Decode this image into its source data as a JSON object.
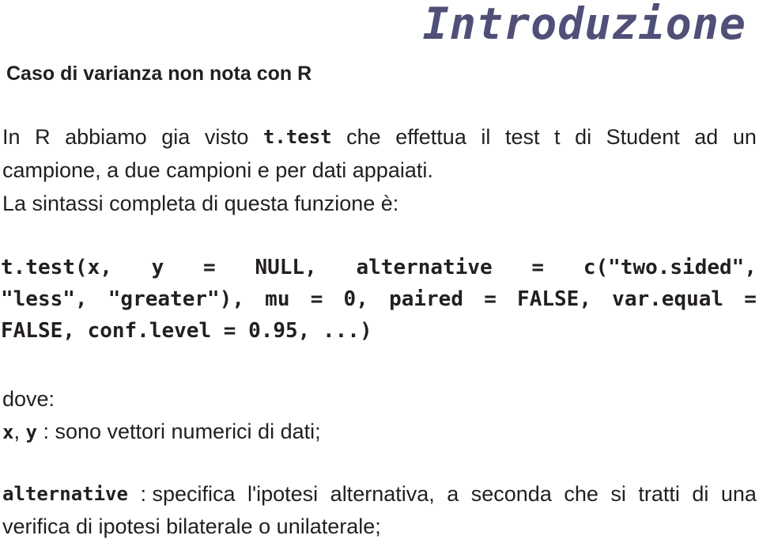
{
  "slide": {
    "title": "Introduzione",
    "subtitle": "Caso di varianza non nota con R",
    "title_color": "#4f4f78",
    "text_color": "#231f20",
    "background_color": "#ffffff"
  },
  "intro": {
    "line1_part1": "In",
    "line1_part2": "R",
    "line1_part3": "abbiamo",
    "line1_part4": "gia",
    "line1_part5": "visto",
    "line1_code": "t.test",
    "line1_part6": "che",
    "line1_part7": "effettua",
    "line1_part8": "il",
    "line1_part9": "test",
    "line1_part10": "t",
    "line1_part11": "di",
    "line1_part12": "Student",
    "line1_part13": "ad",
    "line1_part14": "un",
    "line2": "campione, a due campioni e per dati appaiati.",
    "line3": "La sintassi completa di questa funzione è:"
  },
  "code": {
    "line1_seg1": "t.test(x,",
    "line1_seg2": "y",
    "line1_seg3": "=",
    "line1_seg4": "NULL,",
    "line1_seg5": "alternative",
    "line1_seg6": "=",
    "line1_seg7": "c(\"two.sided\",",
    "line2_seg1": "\"less\",",
    "line2_seg2": "\"greater\"),",
    "line2_seg3": "mu",
    "line2_seg4": "=",
    "line2_seg5": "0,",
    "line2_seg6": "paired",
    "line2_seg7": "=",
    "line2_seg8": "FALSE,",
    "line2_seg9": "var.equal",
    "line2_seg10": "=",
    "line3": "FALSE, conf.level = 0.95, ...)"
  },
  "dove": {
    "label": "dove:",
    "xy_x": "x",
    "xy_sep": ",",
    "xy_y": "y",
    "xy_desc": ": sono vettori numerici di dati;"
  },
  "alternative": {
    "name": "alternative",
    "line1_seg1": ": specifica",
    "line1_seg2": "l'ipotesi",
    "line1_seg3": "alternativa,",
    "line1_seg4": "a",
    "line1_seg5": "seconda",
    "line1_seg6": "che",
    "line1_seg7": "si",
    "line1_seg8": "tratti",
    "line1_seg9": "di",
    "line1_seg10": "una",
    "line2": "verifica di ipotesi bilaterale o unilaterale;"
  }
}
